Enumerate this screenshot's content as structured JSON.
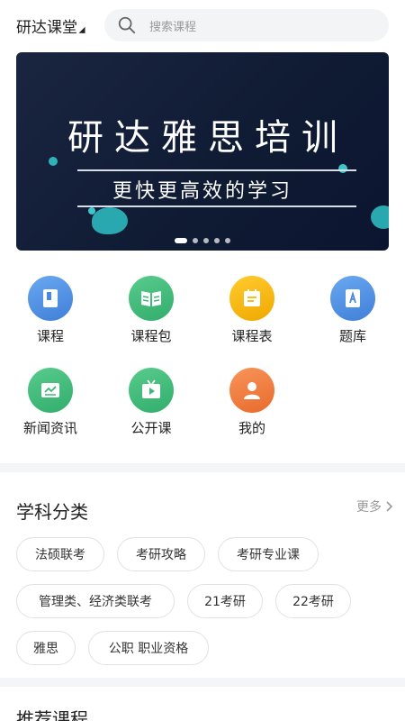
{
  "header": {
    "brand": "研达课堂",
    "search_placeholder": "搜索课程"
  },
  "banner": {
    "title": "研达雅思培训",
    "subtitle": "更快更高效的学习",
    "slides": 5,
    "active_slide": 1
  },
  "grid": {
    "items": [
      {
        "label": "课程",
        "icon": "course-icon",
        "color": "#4a90e2"
      },
      {
        "label": "课程包",
        "icon": "book-package-icon",
        "color": "#3cb878"
      },
      {
        "label": "课程表",
        "icon": "schedule-icon",
        "color": "#f5b800"
      },
      {
        "label": "题库",
        "icon": "question-bank-icon",
        "color": "#4a90e2"
      },
      {
        "label": "新闻资讯",
        "icon": "news-icon",
        "color": "#3cb878"
      },
      {
        "label": "公开课",
        "icon": "open-class-icon",
        "color": "#3cb878"
      },
      {
        "label": "我的",
        "icon": "profile-icon",
        "color": "#f07a3b"
      }
    ]
  },
  "subjects": {
    "title": "学科分类",
    "more": "更多",
    "tags": [
      "法硕联考",
      "考研攻略",
      "考研专业课",
      "管理类、经济类联考",
      "21考研",
      "22考研",
      "雅思",
      "公职 职业资格"
    ]
  },
  "recommended": {
    "title": "推荐课程"
  },
  "colors": {
    "banner_bg": "#13203a",
    "accent_teal": "#2fb2b7"
  }
}
